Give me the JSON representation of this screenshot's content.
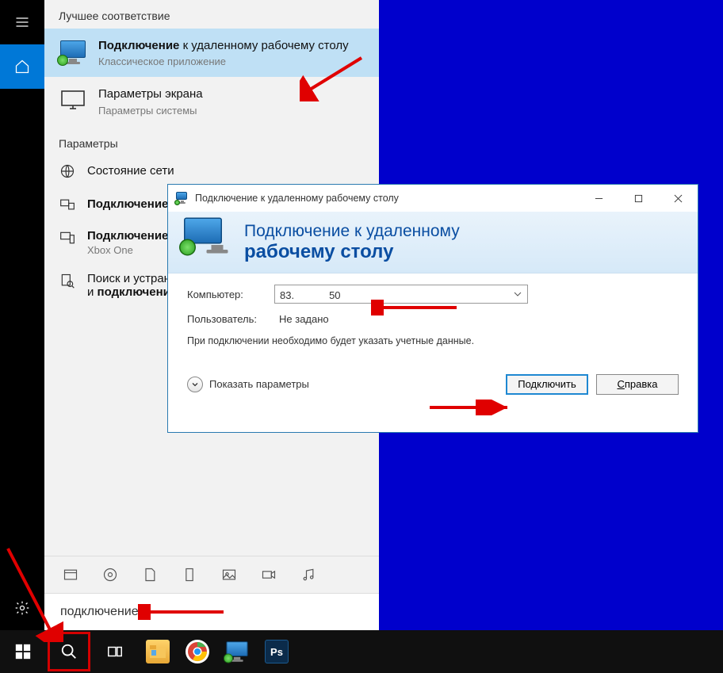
{
  "start": {
    "best_match_header": "Лучшее соответствие",
    "result1": {
      "title_bold": "Подключение",
      "title_rest": " к удаленному рабочему столу",
      "subtitle": "Классическое приложение"
    },
    "result2": {
      "title": "Параметры экрана",
      "subtitle": "Параметры системы"
    },
    "params_header": "Параметры",
    "param_items": [
      {
        "text": "Состояние сети"
      },
      {
        "text_bold": "Подключение"
      },
      {
        "text_prefix_bold": "Подключение",
        "text_rest_visible": "",
        "sub": "Xbox One"
      },
      {
        "text_prefix": "Поиск и устранение",
        "text_conn": "подключени",
        "text_suffix_visible": "и "
      }
    ],
    "search_query": "подключение"
  },
  "rdp": {
    "titlebar": "Подключение к удаленному рабочему столу",
    "header_line1": "Подключение к удаленному",
    "header_line2": "рабочему столу",
    "label_computer": "Компьютер:",
    "computer_value_pre": "83.",
    "computer_value_post": "50",
    "label_user": "Пользователь:",
    "user_value": "Не задано",
    "hint": "При подключении необходимо будет указать учетные данные.",
    "show_params": "Показать параметры",
    "btn_connect": "Подключить",
    "btn_help_u": "С",
    "btn_help_rest": "правка"
  },
  "taskbar": {
    "apps": [
      "explorer",
      "chrome",
      "rdp",
      "photoshop"
    ]
  }
}
